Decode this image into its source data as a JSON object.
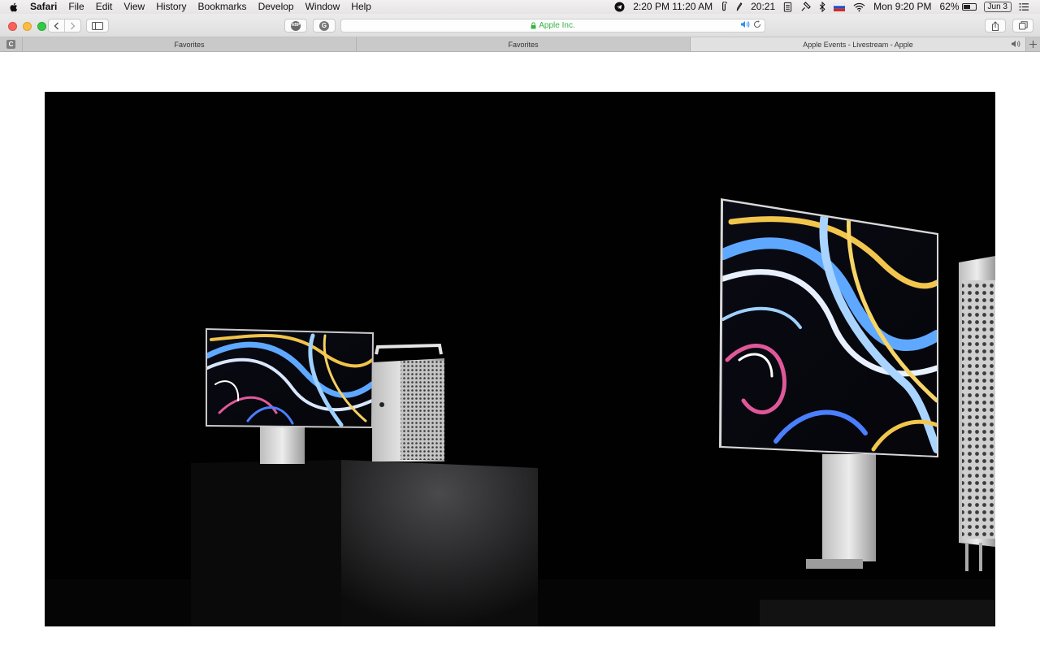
{
  "menubar": {
    "app_name": "Safari",
    "menus": [
      "File",
      "Edit",
      "View",
      "History",
      "Bookmarks",
      "Develop",
      "Window",
      "Help"
    ],
    "clock_1": "2:20 PM 11:20 AM",
    "clock_2": "20:21",
    "battery_percent": "62%",
    "battery_level": 0.62,
    "day_time": "Mon 9:20 PM",
    "date_badge": "Jun 3"
  },
  "toolbar": {
    "address_text": "Apple Inc.",
    "extensions": [
      "ABP",
      "G"
    ],
    "secure": true
  },
  "tabs": {
    "pinned_label": "C",
    "items": [
      {
        "title": "Favorites"
      },
      {
        "title": "Favorites"
      },
      {
        "title": "Apple Events - Livestream - Apple",
        "active": true,
        "audio": true
      }
    ]
  },
  "colors": {
    "address_green": "#3ab34a",
    "video_background": "#020102",
    "close": "#fc605c",
    "minimize": "#fdbc40",
    "maximize": "#34c84a"
  },
  "icons": [
    "apple-logo-icon",
    "telegram-icon",
    "paperclip-icon",
    "pen-icon",
    "clipboard-icon",
    "satellite-icon",
    "bluetooth-icon",
    "flag-icon",
    "wifi-icon",
    "battery-icon",
    "list-icon",
    "back-icon",
    "forward-icon",
    "sidebar-icon",
    "lock-icon",
    "speaker-icon",
    "reload-icon",
    "share-icon",
    "tabs-overview-icon",
    "new-tab-icon"
  ]
}
